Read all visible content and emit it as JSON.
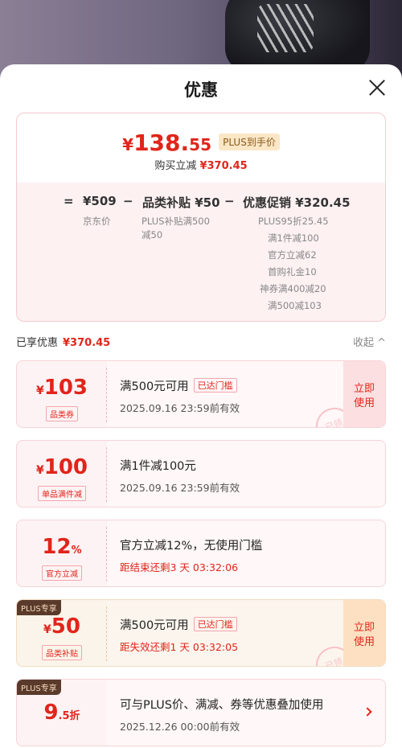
{
  "header": {
    "title": "优惠"
  },
  "summary": {
    "price_yen": "¥",
    "price_int": "138.",
    "price_dec": "55",
    "plus_tag": "PLUS到手价",
    "buy_label": "购买立减",
    "buy_amount": "¥370.45",
    "eq": "=",
    "jd_price": "¥509",
    "minus1": "−",
    "cat_subsidy": "品类补贴 ¥50",
    "minus2": "−",
    "promo": "优惠促销 ¥320.45",
    "jd_price_label": "京东价",
    "cat_sub_lines": [
      "PLUS补贴满500",
      "减50"
    ],
    "promo_lines": [
      "PLUS95折25.45",
      "满1件减100",
      "官方立减62",
      "首购礼金10",
      "神券满400减20",
      "满500减103"
    ]
  },
  "enjoyed": {
    "label": "已享优惠",
    "amount": "¥370.45",
    "collapse": "收起 ^"
  },
  "coupons": [
    {
      "yen": "¥",
      "num": "103",
      "unit": "",
      "kind": "品类券",
      "desc": "满500元可用",
      "tag": "已达门槛",
      "time": "2025.09.16  23:59前有效",
      "action_1": "立即",
      "action_2": "使用",
      "stamp": "已领"
    },
    {
      "yen": "¥",
      "num": "100",
      "unit": "",
      "kind": "单品满件减",
      "desc": "满1件减100元",
      "time": "2025.09.16  23:59前有效"
    },
    {
      "yen": "",
      "num": "12",
      "unit": "%",
      "kind": "官方立减",
      "desc": "官方立减12%，无使用门槛",
      "time": "距结束还剩3 天  03:32:06"
    },
    {
      "badge": "PLUS专享",
      "yen": "¥",
      "num": "50",
      "unit": "",
      "kind": "品类补贴",
      "desc": "满500元可用",
      "tag": "已达门槛",
      "time": "距失效还剩1 天  03:32:05",
      "action_1": "立即",
      "action_2": "使用",
      "stamp": "已领"
    },
    {
      "badge": "PLUS专享",
      "yen": "",
      "num": "9",
      "unit": ".5折",
      "desc": "可与PLUS价、满减、券等优惠叠加使用",
      "time": "2025.12.26  00:00前有效"
    }
  ]
}
